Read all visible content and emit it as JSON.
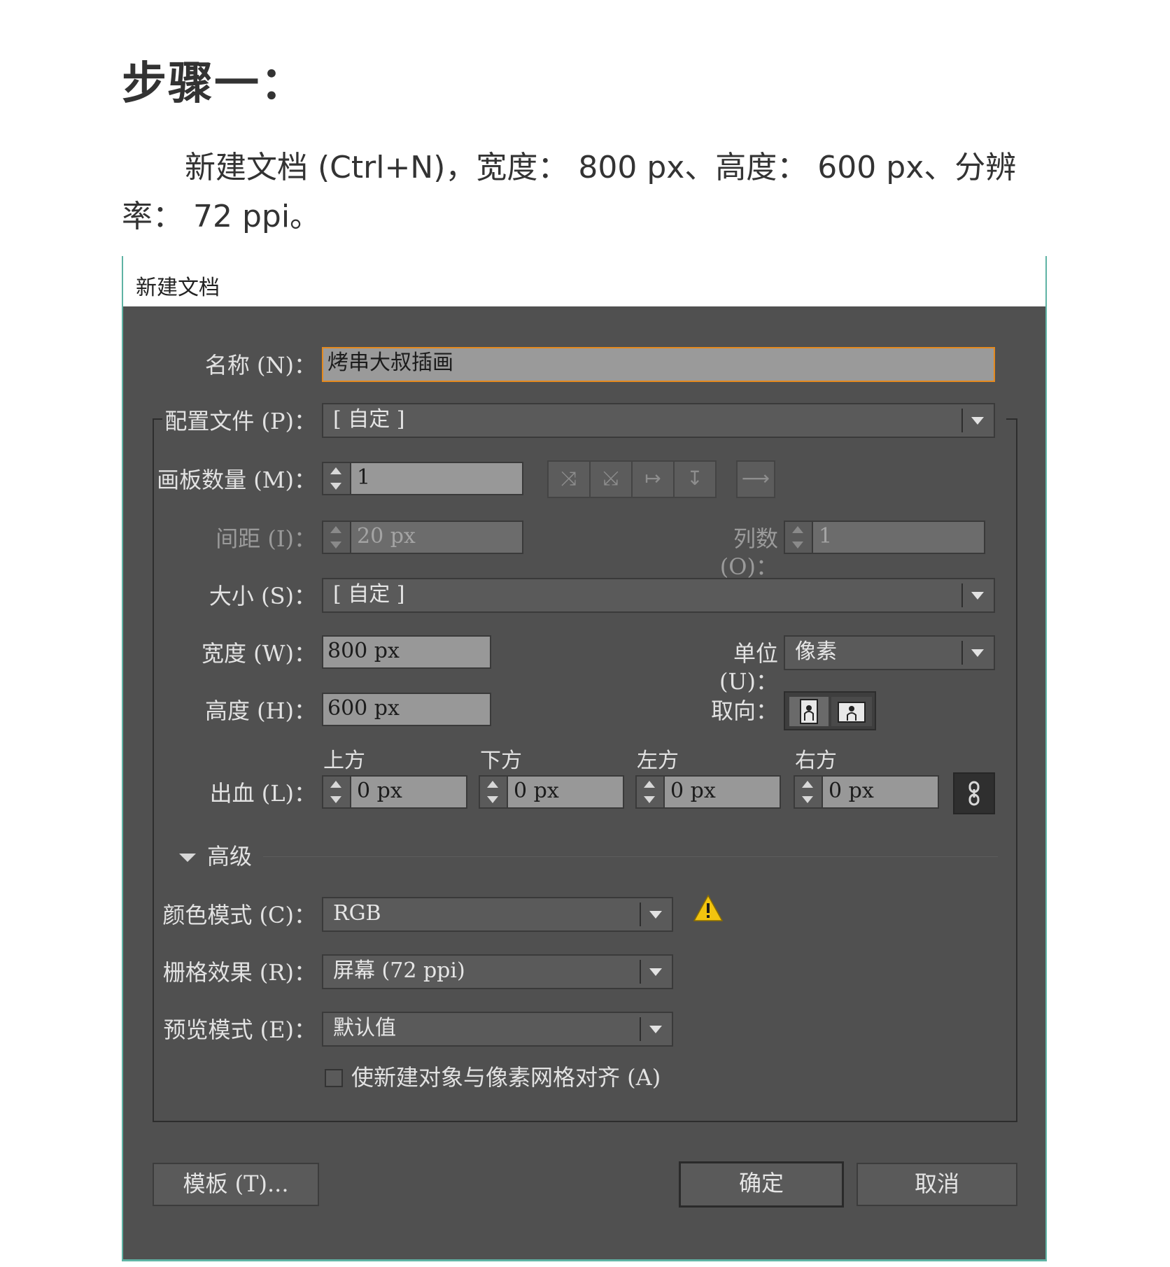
{
  "heading": "步骤一：",
  "intro": "新建文档 (Ctrl+N)，宽度： 800 px、高度： 600 px、分辨率： 72 ppi。",
  "dialog": {
    "title": "新建文档",
    "name_label": "名称 (N)：",
    "name_value": "烤串大叔插画",
    "profile_label": "配置文件 (P)：",
    "profile_value": "[ 自定 ]",
    "artboards_label": "画板数量 (M)：",
    "artboards_value": "1",
    "spacing_label": "间距 (I)：",
    "spacing_value": "20 px",
    "columns_label": "列数 (O)：",
    "columns_value": "1",
    "size_label": "大小 (S)：",
    "size_value": "[ 自定 ]",
    "width_label": "宽度 (W)：",
    "width_value": "800 px",
    "units_label": "单位 (U)：",
    "units_value": "像素",
    "height_label": "高度 (H)：",
    "height_value": "600 px",
    "orientation_label": "取向：",
    "bleed_label": "出血 (L)：",
    "bleed": {
      "top_label": "上方",
      "top_value": "0 px",
      "bottom_label": "下方",
      "bottom_value": "0 px",
      "left_label": "左方",
      "left_value": "0 px",
      "right_label": "右方",
      "right_value": "0 px"
    },
    "advanced_label": "高级",
    "color_mode_label": "颜色模式 (C)：",
    "color_mode_value": "RGB",
    "raster_label": "栅格效果 (R)：",
    "raster_value": "屏幕 (72 ppi)",
    "preview_label": "预览模式 (E)：",
    "preview_value": "默认值",
    "align_checkbox_label": "使新建对象与像素网格对齐 (A)",
    "align_checked": false,
    "templates_button": "模板 (T)...",
    "ok_button": "确定",
    "cancel_button": "取消",
    "warning_color": "#f2c40f",
    "focus_color": "#e48a1f"
  }
}
